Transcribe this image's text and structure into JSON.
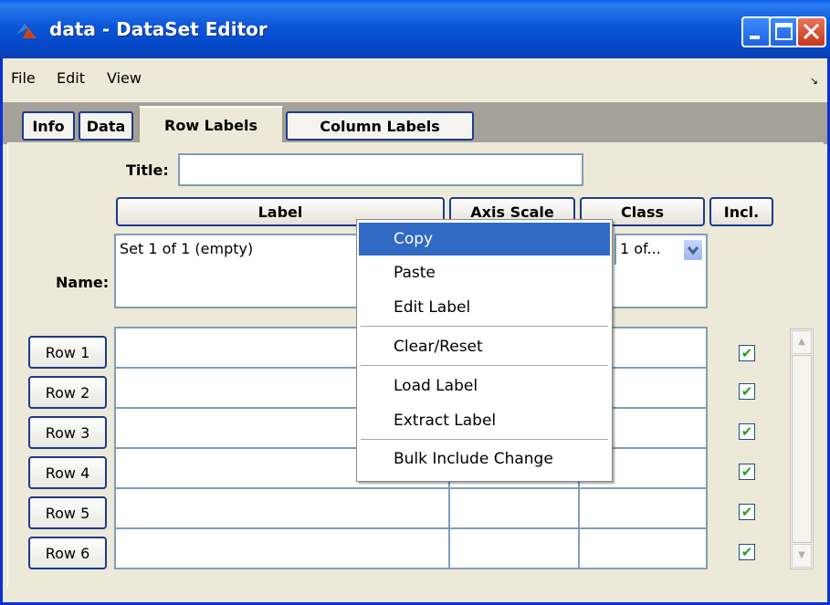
{
  "window": {
    "title": "data - DataSet Editor"
  },
  "menu": {
    "file": "File",
    "edit": "Edit",
    "view": "View"
  },
  "tabs": {
    "info": "Info",
    "data": "Data",
    "row_labels": "Row Labels",
    "column_labels": "Column Labels"
  },
  "form": {
    "title_label": "Title:",
    "title_value": "",
    "name_label": "Name:",
    "name_value": ""
  },
  "header": {
    "label": "Label",
    "axis_scale": "Axis Scale",
    "class": "Class",
    "incl": "Incl."
  },
  "label_set_select": {
    "value": "Set 1 of 1 (empty)"
  },
  "class_set_select": {
    "value": "1 of..."
  },
  "rows": [
    {
      "label": "Row 1",
      "included": true
    },
    {
      "label": "Row 2",
      "included": true
    },
    {
      "label": "Row 3",
      "included": true
    },
    {
      "label": "Row 4",
      "included": true
    },
    {
      "label": "Row 5",
      "included": true
    },
    {
      "label": "Row 6",
      "included": true
    }
  ],
  "context_menu": {
    "copy": "Copy",
    "paste": "Paste",
    "edit_label": "Edit Label",
    "clear_reset": "Clear/Reset",
    "load_label": "Load Label",
    "extract_label": "Extract Label",
    "bulk_include_change": "Bulk Include Change",
    "highlighted": "Copy"
  },
  "icons": {
    "app": "matlab-logo-icon",
    "minimize": "minimize-icon",
    "maximize": "maximize-icon",
    "close": "close-icon",
    "menu_overflow": "arrow-icon",
    "dropdown": "chevron-down-icon",
    "checkbox": "checkmark-icon",
    "scroll_up": "scroll-up-icon",
    "scroll_down": "scroll-down-icon"
  },
  "colors": {
    "title_bar": "#0b56d8",
    "highlight": "#316ac5",
    "close_button": "#d84a2c",
    "check": "#21a121"
  }
}
